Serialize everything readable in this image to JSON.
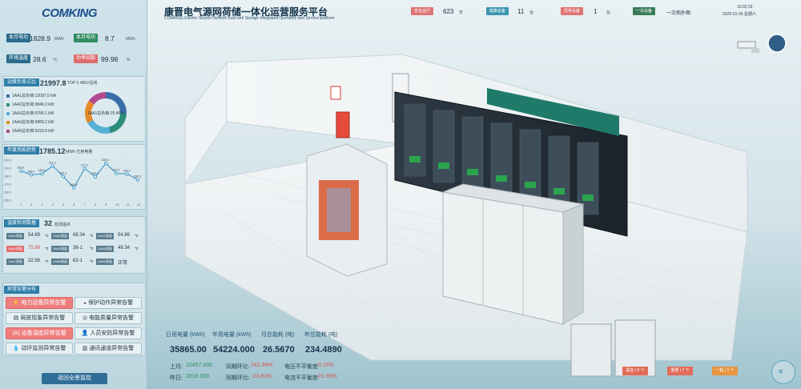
{
  "brand": {
    "logo": "COMKING"
  },
  "header": {
    "title": "康晋电气源网荷储一体化运营服务平台",
    "subtitle": "COMKING Electric Source Network load and Storage Integrated Operation and Service platform",
    "stats": [
      {
        "tag": "安全运行",
        "value": "623",
        "unit": "天",
        "color": "#e07373"
      },
      {
        "tag": "健康设备",
        "value": "11",
        "unit": "台",
        "color": "#3c95b2"
      },
      {
        "tag": "异常设备",
        "value": "1",
        "unit": "台",
        "color": "#e07373"
      },
      {
        "tag": "一次设备",
        "value": "一次拓扑图",
        "unit": "",
        "color": "#3a7c59"
      }
    ],
    "time": "10:02:39",
    "date": "2025-01-06 星期六"
  },
  "left": {
    "kpis": [
      {
        "label": "本月电功",
        "value": "1828.9",
        "unit": "MWh",
        "style": "default"
      },
      {
        "label": "本月电功",
        "value": "8.7",
        "unit": "MWh",
        "style": "green"
      },
      {
        "label": "环境温度",
        "value": "28.6",
        "unit": "℃",
        "style": "default"
      },
      {
        "label": "功率因数",
        "value": "99.98",
        "unit": "%",
        "style": "red"
      }
    ],
    "load": {
      "title": "运维负荷占比",
      "value": "21997.8",
      "note": "TOP 5 480V总线",
      "items": [
        {
          "label": "1AA1总负荷:12097.5 kW",
          "color": "#3a6ea8"
        },
        {
          "label": "1AA2总负荷:9846.3 kW",
          "color": "#2d8c7b"
        },
        {
          "label": "1AA3总负荷:9786.1 kW",
          "color": "#56b0d6"
        },
        {
          "label": "1AA4总负荷:6889.2 kW",
          "color": "#e58a2a"
        },
        {
          "label": "1AA5总负荷:5233.9 kW",
          "color": "#b04a8d"
        }
      ],
      "donut_label": "1AA1总负荷:25.46%",
      "shares": [
        25.46,
        21.0,
        20.5,
        18.0,
        15.04
      ]
    },
    "trend": {
      "title": "年度用能趋势",
      "value": "1785.12",
      "unit": "MWh·已用电量"
    },
    "temp": {
      "title": "温度检测数据",
      "count": "32",
      "count_label": "检测温点",
      "items": [
        {
          "tag": "1AA1测温",
          "value": "54.89",
          "unit": "℃",
          "alert": false
        },
        {
          "tag": "1AA2测温",
          "value": "68.34",
          "unit": "℃",
          "alert": false
        },
        {
          "tag": "1AA3测温",
          "value": "54.89",
          "unit": "℃",
          "alert": false
        },
        {
          "tag": "1AA4测温",
          "value": "75.86",
          "unit": "℃",
          "alert": true
        },
        {
          "tag": "1AA5测温",
          "value": "36-1",
          "unit": "℃",
          "alert": false
        },
        {
          "tag": "1AA6测温",
          "value": "48.34",
          "unit": "℃",
          "alert": false
        },
        {
          "tag": "1AA7测温",
          "value": "32.56",
          "unit": "℃",
          "alert": false
        },
        {
          "tag": "1AA8测温",
          "value": "62-1",
          "unit": "℃",
          "alert": false
        },
        {
          "tag": "1AA9测温",
          "value": "正常",
          "unit": "",
          "alert": false
        }
      ]
    },
    "alarms": {
      "title": "异常告警分布",
      "items": [
        {
          "label": "电力设备异常告警",
          "icon": "⚡",
          "on": true
        },
        {
          "label": "保护动作异常告警",
          "icon": "◒",
          "on": false
        },
        {
          "label": "局放现象异常告警",
          "icon": "▤",
          "on": false
        },
        {
          "label": "电能质量异常告警",
          "icon": "◎",
          "on": false
        },
        {
          "label": "(A) 设备温度异常告警",
          "icon": "",
          "on": true
        },
        {
          "label": "人员安防异常告警",
          "icon": "👤",
          "on": false
        },
        {
          "label": "动环监测异常告警",
          "icon": "💧",
          "on": false
        },
        {
          "label": "通讯通道异常告警",
          "icon": "▥",
          "on": false
        }
      ]
    },
    "return_button": "返回全景监控"
  },
  "bottom": {
    "labels": [
      "日用电量 (kWh)",
      "年用电量 (kWh)",
      "月总能耗 (吨)",
      "年总能耗 (吨)"
    ],
    "values": [
      "35865.00",
      "54224.000",
      "26.5670",
      "234.4890"
    ],
    "rows": [
      {
        "a": "上月:",
        "b": "10457.000",
        "c": "同期环比:",
        "d": "242.98%",
        "e": "电压不平衡度",
        "f": "0.15%"
      },
      {
        "a": "昨日:",
        "b": "2818.000",
        "c": "同期环比:",
        "d": "-23.80%",
        "e": "电流不平衡度",
        "f": "21.66%"
      }
    ]
  },
  "bottom_right": [
    {
      "label": "紧急 | 0 个",
      "color": "#e26b5a"
    },
    {
      "label": "重要 | 7 个",
      "color": "#e26b5a"
    },
    {
      "label": "一般 | 1 个",
      "color": "#e6943e"
    }
  ],
  "chart_data": {
    "type": "line",
    "categories": [
      "1",
      "2",
      "3",
      "4",
      "5",
      "6",
      "7",
      "8",
      "9",
      "10",
      "11",
      "12"
    ],
    "series": [
      {
        "values": [
          193.8,
          188.0,
          189.5,
          201.2,
          185.3,
          168.3,
          197.5,
          185.0,
          205.0,
          190.0,
          189.2,
          180.5
        ]
      }
    ],
    "ylim": [
      150,
      210
    ],
    "yticks": [
      "200.0",
      "190.0",
      "180.0",
      "170.0",
      "160.0",
      "150.0"
    ]
  },
  "colors": {
    "panel_accent": "#2f7ea8",
    "alarm_red": "#ee7e7e",
    "good_green": "#2f8c62"
  }
}
